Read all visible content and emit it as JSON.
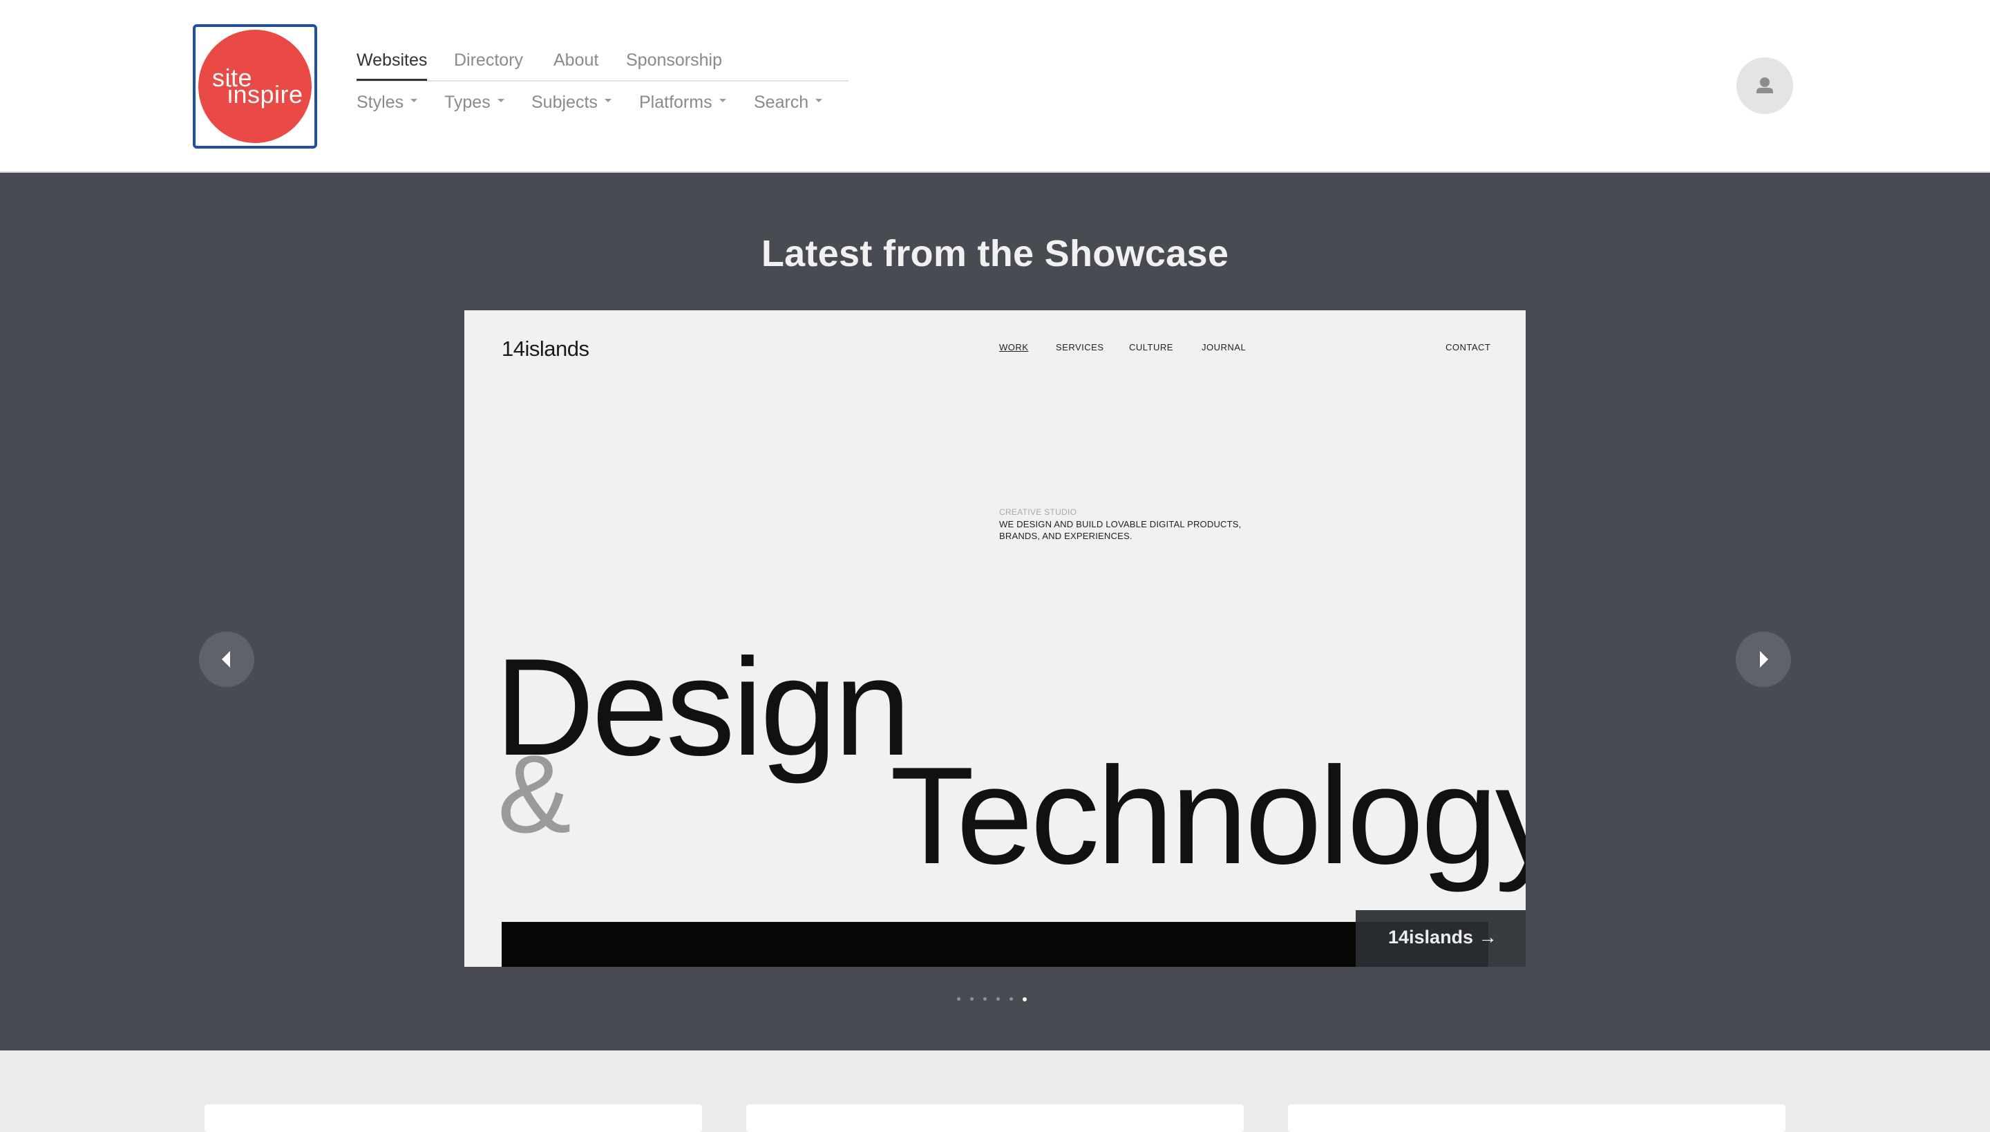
{
  "logo": {
    "line1": "site",
    "line2": "inspire"
  },
  "primary_nav": [
    {
      "label": "Websites",
      "active": true
    },
    {
      "label": "Directory",
      "active": false
    },
    {
      "label": "About",
      "active": false
    },
    {
      "label": "Sponsorship",
      "active": false
    }
  ],
  "secondary_nav": [
    {
      "label": "Styles"
    },
    {
      "label": "Types"
    },
    {
      "label": "Subjects"
    },
    {
      "label": "Platforms"
    },
    {
      "label": "Search"
    }
  ],
  "user_menu": {
    "icon": "user-icon"
  },
  "showcase": {
    "title": "Latest from the Showcase",
    "slide": {
      "site_logo": "14islands",
      "site_nav": [
        "WORK",
        "SERVICES",
        "CULTURE",
        "JOURNAL"
      ],
      "site_contact": "CONTACT",
      "tagline_small": "CREATIVE STUDIO",
      "tagline_line1": "WE DESIGN AND BUILD LOVABLE DIGITAL PRODUCTS,",
      "tagline_line2": "BRANDS, AND EXPERIENCES.",
      "headline_1": "Design",
      "headline_amp": "&",
      "headline_2": "Technology",
      "caption": "14islands →"
    },
    "prev_icon": "chevron-left-icon",
    "next_icon": "chevron-right-icon",
    "slide_count": 6,
    "active_slide": 6
  },
  "colors": {
    "header_bg": "#ffffff",
    "showcase_bg": "#484c52",
    "logo_red": "#e94a45",
    "logo_border": "#1f4fa8",
    "page_bg": "#ebebeb"
  }
}
